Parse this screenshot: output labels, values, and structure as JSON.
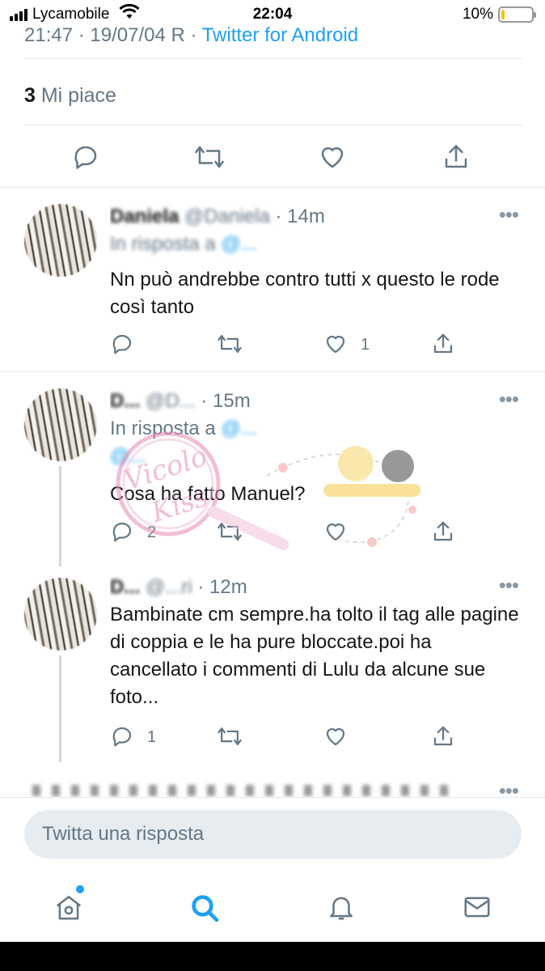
{
  "status_bar": {
    "carrier": "Lycamobile",
    "time": "22:04",
    "battery_percent": "10%",
    "battery_level": 0.1
  },
  "tweet": {
    "timestamp": "21:47 · 19/07/04 R",
    "via": "Twitter for Android",
    "likes_count": "3",
    "likes_label": "Mi piace"
  },
  "replies": [
    {
      "name": "Daniela",
      "handle": "@Daniela",
      "time": "· 14m",
      "replying_label": "In risposta a",
      "replying_to": "@...",
      "text": "Nn può andrebbe contro tutti x questo le rode così tanto",
      "reply_count": "",
      "like_count": "1"
    },
    {
      "name": "D...",
      "handle": "@D...",
      "time": "· 15m",
      "replying_label": "In risposta a",
      "replying_to": "@...",
      "replying_to_2": "@...",
      "text": "Cosa ha fatto Manuel?",
      "reply_count": "2",
      "like_count": ""
    },
    {
      "name": "D...",
      "handle": "@...ri",
      "time": "· 12m",
      "text": "Bambinate cm sempre.ha tolto il tag alle pagine di coppia e le ha pure bloccate.poi ha cancellato i commenti di Lulu da alcune sue foto...",
      "reply_count": "1",
      "like_count": ""
    }
  ],
  "composer": {
    "placeholder": "Twitta una risposta"
  },
  "watermark": {
    "text": "Vicolo Kiss"
  },
  "nav": {
    "items": [
      "home-icon",
      "search-icon",
      "bell-icon",
      "mail-icon"
    ],
    "active": "search-icon"
  },
  "colors": {
    "accent": "#1da1f2",
    "secondary_text": "#657786",
    "divider": "#e1e8ed"
  }
}
